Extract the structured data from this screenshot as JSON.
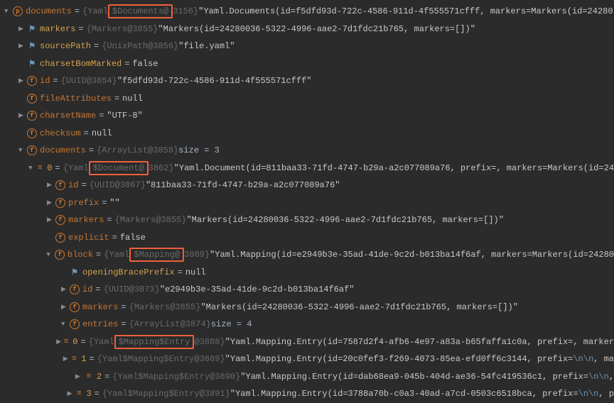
{
  "rows": [
    {
      "indent": 0,
      "arrow": "down",
      "icon": "p",
      "name": "documents",
      "nameClass": "fname",
      "type_pre": "{Yaml",
      "type_hl": "$Documents@",
      "type_post": "3156}",
      "val": "\"Yaml.Documents(id=f5dfd93d-722c-4586-911d-4f555571cfff, markers=Markers(id=24280"
    },
    {
      "indent": 20,
      "arrow": "right",
      "icon": "flag",
      "name": "markers",
      "nameClass": "fname-gold",
      "type": "{Markers@3855}",
      "val": "\"Markers(id=24280036-5322-4996-aae2-7d1fdc21b765, markers=[])\""
    },
    {
      "indent": 20,
      "arrow": "right",
      "icon": "flag",
      "name": "sourcePath",
      "nameClass": "fname-gold",
      "type": "{UnixPath@3856}",
      "val": "\"file.yaml\""
    },
    {
      "indent": 20,
      "arrow": "",
      "icon": "flag",
      "name": "charsetBomMarked",
      "nameClass": "fname-gold",
      "type": "",
      "val": "false"
    },
    {
      "indent": 20,
      "arrow": "right",
      "icon": "f",
      "name": "id",
      "nameClass": "fname",
      "type": "{UUID@3854}",
      "val": "\"f5dfd93d-722c-4586-911d-4f555571cfff\""
    },
    {
      "indent": 20,
      "arrow": "",
      "icon": "f",
      "name": "fileAttributes",
      "nameClass": "fname",
      "type": "",
      "val": "null"
    },
    {
      "indent": 20,
      "arrow": "right",
      "icon": "f",
      "name": "charsetName",
      "nameClass": "fname",
      "type": "",
      "val": "\"UTF-8\""
    },
    {
      "indent": 20,
      "arrow": "",
      "icon": "f",
      "name": "checksum",
      "nameClass": "fname",
      "type": "",
      "val": "null"
    },
    {
      "indent": 20,
      "arrow": "down",
      "icon": "f",
      "name": "documents",
      "nameClass": "fname",
      "type": "{ArrayList@3858}",
      "val": " size = 3",
      "valPlain": true
    },
    {
      "indent": 40,
      "arrow": "down",
      "icon": "list",
      "name": "0",
      "nameClass": "fname-gold",
      "type_pre": "{Yaml",
      "type_hl": "$Document@",
      "type_post": "3862}",
      "val": "\"Yaml.Document(id=811baa33-71fd-4747-b29a-a2c077089a76, prefix=, markers=Markers(id=24"
    },
    {
      "indent": 60,
      "arrow": "right",
      "icon": "f",
      "name": "id",
      "nameClass": "fname",
      "type": "{UUID@3867}",
      "val": "\"811baa33-71fd-4747-b29a-a2c077089a76\""
    },
    {
      "indent": 60,
      "arrow": "right",
      "icon": "f",
      "name": "prefix",
      "nameClass": "fname",
      "type": "",
      "val": "\"\""
    },
    {
      "indent": 60,
      "arrow": "right",
      "icon": "f",
      "name": "markers",
      "nameClass": "fname",
      "type": "{Markers@3855}",
      "val": "\"Markers(id=24280036-5322-4996-aae2-7d1fdc21b765, markers=[])\""
    },
    {
      "indent": 60,
      "arrow": "",
      "icon": "f",
      "name": "explicit",
      "nameClass": "fname",
      "type": "",
      "val": "false"
    },
    {
      "indent": 60,
      "arrow": "down",
      "icon": "f",
      "name": "block",
      "nameClass": "fname",
      "type_pre": "{Yaml",
      "type_hl": "$Mapping@",
      "type_post": "3869}",
      "val": "\"Yaml.Mapping(id=e2949b3e-35ad-41de-9c2d-b013ba14f6af, markers=Markers(id=24280"
    },
    {
      "indent": 80,
      "arrow": "",
      "icon": "flag",
      "name": "openingBracePrefix",
      "nameClass": "fname-gold",
      "type": "",
      "val": "null"
    },
    {
      "indent": 80,
      "arrow": "right",
      "icon": "f",
      "name": "id",
      "nameClass": "fname",
      "type": "{UUID@3873}",
      "val": "\"e2949b3e-35ad-41de-9c2d-b013ba14f6af\""
    },
    {
      "indent": 80,
      "arrow": "right",
      "icon": "f",
      "name": "markers",
      "nameClass": "fname",
      "type": "{Markers@3855}",
      "val": "\"Markers(id=24280036-5322-4996-aae2-7d1fdc21b765, markers=[])\""
    },
    {
      "indent": 80,
      "arrow": "down",
      "icon": "f",
      "name": "entries",
      "nameClass": "fname",
      "type": "{ArrayList@3874}",
      "val": " size = 4",
      "valPlain": true
    },
    {
      "indent": 100,
      "arrow": "right",
      "icon": "list",
      "name": "0",
      "nameClass": "fname-gold",
      "type_pre": "{Yaml",
      "type_hl": "$Mapping$Entry",
      "type_post": "@3888}",
      "val": "\"Yaml.Mapping.Entry(id=7587d2f4-afb6-4e97-a83a-b65faffa1c0a, prefix=, marker"
    },
    {
      "indent": 100,
      "arrow": "right",
      "icon": "list",
      "name": "1",
      "nameClass": "fname-gold",
      "type": "{Yaml$Mapping$Entry@3889}",
      "val": "\"Yaml.Mapping.Entry(id=20c0fef3-f269-4073-85ea-efd0ff6c3144, prefix=",
      "esc": "\\n\\n",
      "valTail": ", ma"
    },
    {
      "indent": 100,
      "arrow": "right",
      "icon": "list",
      "name": "2",
      "nameClass": "fname-gold",
      "type": "{Yaml$Mapping$Entry@3890}",
      "val": "\"Yaml.Mapping.Entry(id=dab68ea9-045b-404d-ae36-54fc419536c1, prefix=",
      "esc": "\\n\\n",
      "valTail": ","
    },
    {
      "indent": 100,
      "arrow": "right",
      "icon": "list",
      "name": "3",
      "nameClass": "fname-gold",
      "type": "{Yaml$Mapping$Entry@3891}",
      "val": "\"Yaml.Mapping.Entry(id=3788a70b-c0a3-40ad-a7cd-0503c6518bca, prefix=",
      "esc": "\\n\\n",
      "valTail": ", p"
    }
  ]
}
